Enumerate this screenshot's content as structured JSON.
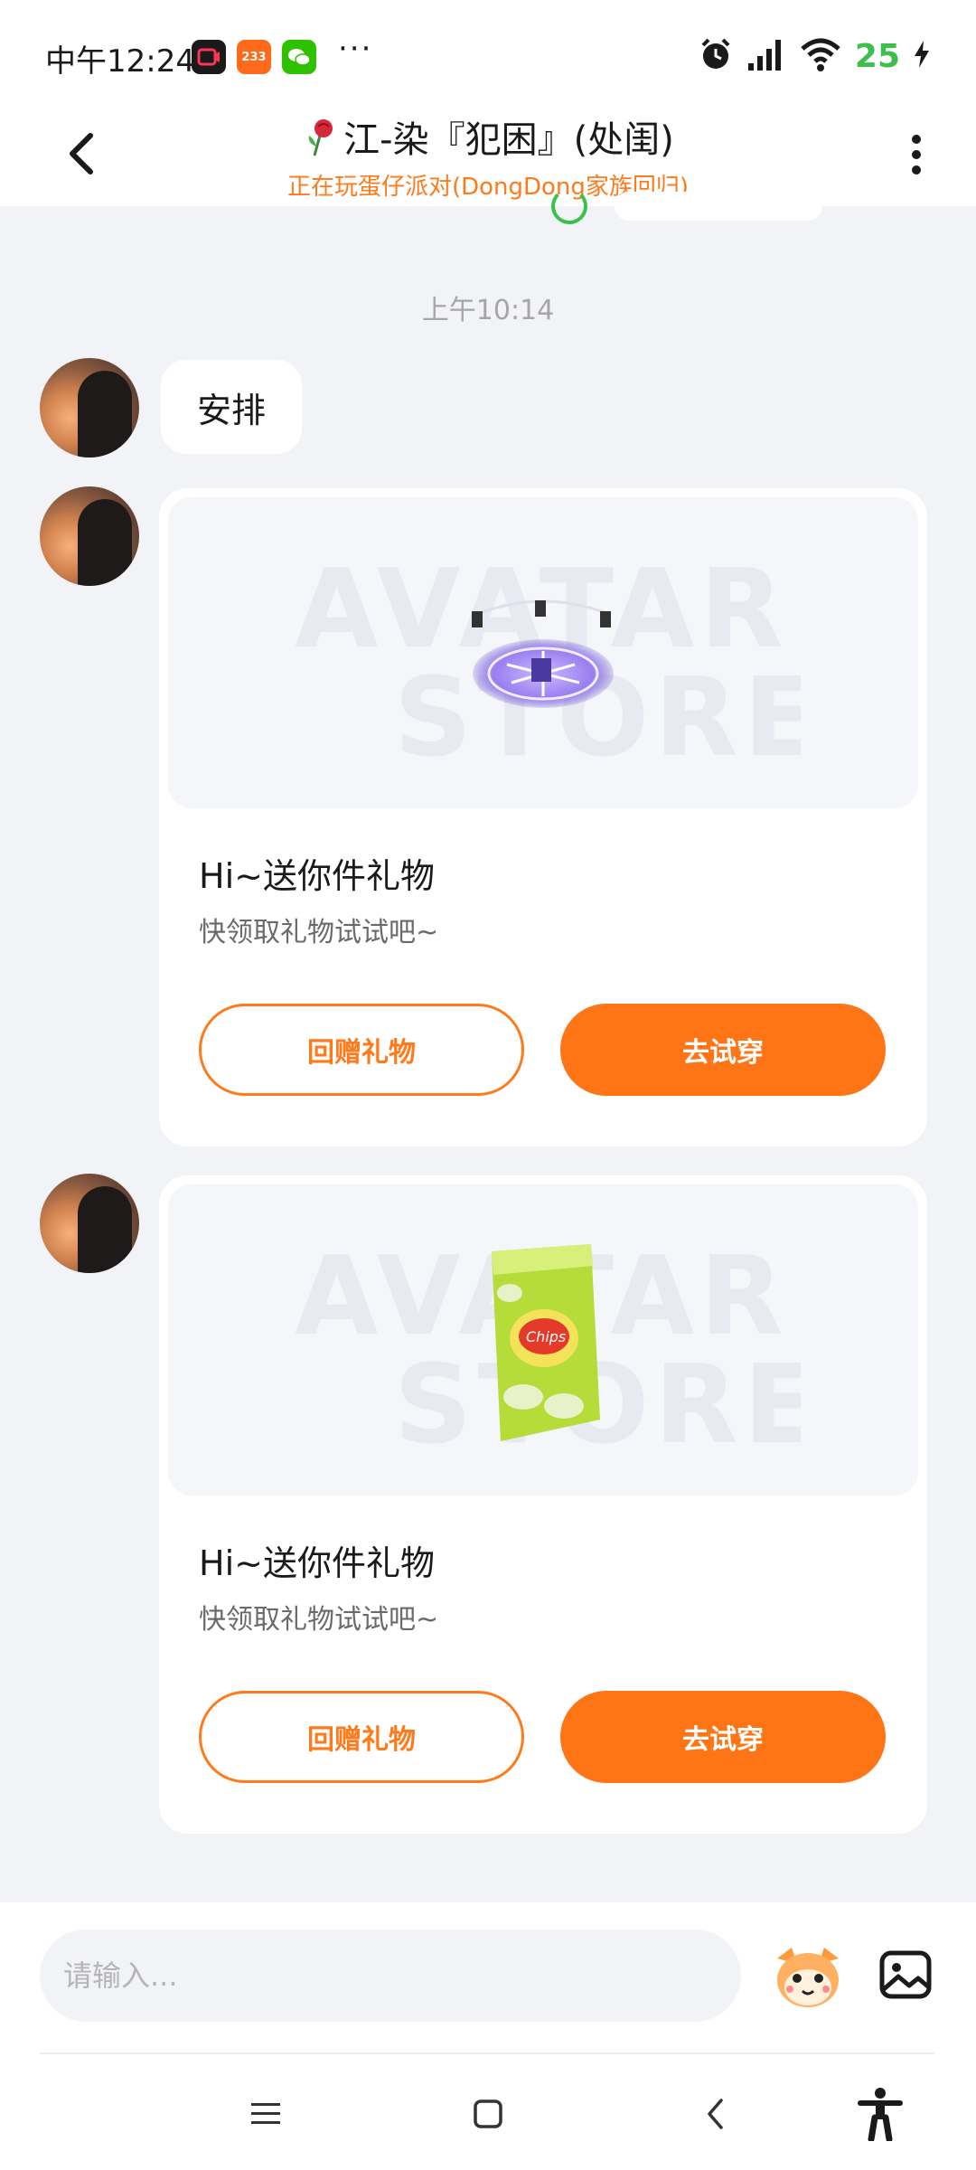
{
  "status_bar": {
    "time": "中午12:24",
    "app_icons": [
      {
        "name": "screen-recorder-icon",
        "color": "#1a1a1a"
      },
      {
        "name": "233-app-icon",
        "label": "233",
        "color": "#ff6a1a"
      },
      {
        "name": "wechat-icon",
        "color": "#2dc100"
      }
    ],
    "more": "···",
    "battery": "25"
  },
  "header": {
    "title": "江-染『犯困』(处闺)",
    "subtitle": "正在玩蛋仔派对(DongDong家族回归)"
  },
  "chat": {
    "timestamp": "上午10:14",
    "text_message": "安排",
    "gift_cards": [
      {
        "item": "magic-circle-gift",
        "watermark": "AVATAR STORE",
        "title": "Hi~送你件礼物",
        "subtitle": "快领取礼物试试吧~",
        "return_gift_label": "回赠礼物",
        "try_on_label": "去试穿"
      },
      {
        "item": "chips-bag-gift",
        "watermark": "AVATAR STORE",
        "title": "Hi~送你件礼物",
        "subtitle": "快领取礼物试试吧~",
        "return_gift_label": "回赠礼物",
        "try_on_label": "去试穿"
      }
    ]
  },
  "input": {
    "placeholder": "请输入..."
  },
  "colors": {
    "accent": "#ff7414",
    "background": "#f2f3f7",
    "battery_green": "#3cbf4b"
  }
}
